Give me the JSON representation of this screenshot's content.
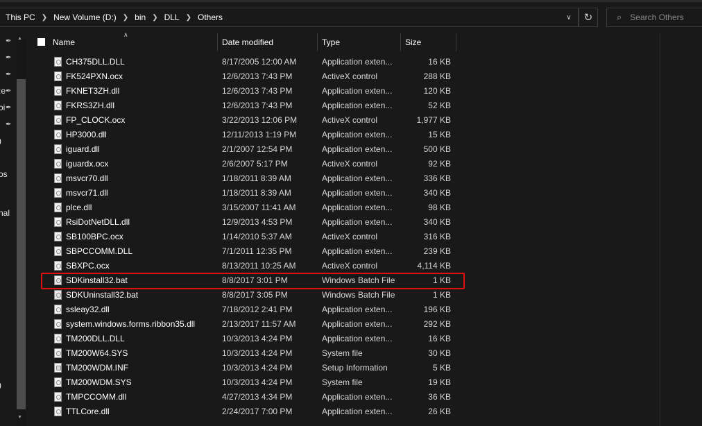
{
  "address": {
    "breadcrumbs": [
      "This PC",
      "New Volume (D:)",
      "bin",
      "DLL",
      "Others"
    ]
  },
  "search": {
    "placeholder": "Search Others"
  },
  "nav_fragments": [
    ":e",
    "oi",
    ")",
    "os",
    "nal",
    ")"
  ],
  "columns": {
    "name": "Name",
    "date": "Date modified",
    "type": "Type",
    "size": "Size"
  },
  "files": [
    {
      "name": "CH375DLL.DLL",
      "date": "8/17/2005 12:00 AM",
      "type": "Application exten...",
      "size": "16 KB",
      "icon": "dll"
    },
    {
      "name": "FK524PXN.ocx",
      "date": "12/6/2013 7:43 PM",
      "type": "ActiveX control",
      "size": "288 KB",
      "icon": "dll"
    },
    {
      "name": "FKNET3ZH.dll",
      "date": "12/6/2013 7:43 PM",
      "type": "Application exten...",
      "size": "120 KB",
      "icon": "dll"
    },
    {
      "name": "FKRS3ZH.dll",
      "date": "12/6/2013 7:43 PM",
      "type": "Application exten...",
      "size": "52 KB",
      "icon": "dll"
    },
    {
      "name": "FP_CLOCK.ocx",
      "date": "3/22/2013 12:06 PM",
      "type": "ActiveX control",
      "size": "1,977 KB",
      "icon": "dll"
    },
    {
      "name": "HP3000.dll",
      "date": "12/11/2013 1:19 PM",
      "type": "Application exten...",
      "size": "15 KB",
      "icon": "dll"
    },
    {
      "name": "iguard.dll",
      "date": "2/1/2007 12:54 PM",
      "type": "Application exten...",
      "size": "500 KB",
      "icon": "dll"
    },
    {
      "name": "iguardx.ocx",
      "date": "2/6/2007 5:17 PM",
      "type": "ActiveX control",
      "size": "92 KB",
      "icon": "dll"
    },
    {
      "name": "msvcr70.dll",
      "date": "1/18/2011 8:39 AM",
      "type": "Application exten...",
      "size": "336 KB",
      "icon": "dll"
    },
    {
      "name": "msvcr71.dll",
      "date": "1/18/2011 8:39 AM",
      "type": "Application exten...",
      "size": "340 KB",
      "icon": "dll"
    },
    {
      "name": "plce.dll",
      "date": "3/15/2007 11:41 AM",
      "type": "Application exten...",
      "size": "98 KB",
      "icon": "dll"
    },
    {
      "name": "RsiDotNetDLL.dll",
      "date": "12/9/2013 4:53 PM",
      "type": "Application exten...",
      "size": "340 KB",
      "icon": "dll"
    },
    {
      "name": "SB100BPC.ocx",
      "date": "1/14/2010 5:37 AM",
      "type": "ActiveX control",
      "size": "316 KB",
      "icon": "dll"
    },
    {
      "name": "SBPCCOMM.DLL",
      "date": "7/1/2011 12:35 PM",
      "type": "Application exten...",
      "size": "239 KB",
      "icon": "dll"
    },
    {
      "name": "SBXPC.ocx",
      "date": "8/13/2011 10:25 AM",
      "type": "ActiveX control",
      "size": "4,114 KB",
      "icon": "dll"
    },
    {
      "name": "SDKinstall32.bat",
      "date": "8/8/2017 3:01 PM",
      "type": "Windows Batch File",
      "size": "1 KB",
      "icon": "bat"
    },
    {
      "name": "SDKUninstall32.bat",
      "date": "8/8/2017 3:05 PM",
      "type": "Windows Batch File",
      "size": "1 KB",
      "icon": "bat"
    },
    {
      "name": "ssleay32.dll",
      "date": "7/18/2012 2:41 PM",
      "type": "Application exten...",
      "size": "196 KB",
      "icon": "dll"
    },
    {
      "name": "system.windows.forms.ribbon35.dll",
      "date": "2/13/2017 11:57 AM",
      "type": "Application exten...",
      "size": "292 KB",
      "icon": "dll"
    },
    {
      "name": "TM200DLL.DLL",
      "date": "10/3/2013 4:24 PM",
      "type": "Application exten...",
      "size": "16 KB",
      "icon": "dll"
    },
    {
      "name": "TM200W64.SYS",
      "date": "10/3/2013 4:24 PM",
      "type": "System file",
      "size": "30 KB",
      "icon": "sys"
    },
    {
      "name": "TM200WDM.INF",
      "date": "10/3/2013 4:24 PM",
      "type": "Setup Information",
      "size": "5 KB",
      "icon": "inf"
    },
    {
      "name": "TM200WDM.SYS",
      "date": "10/3/2013 4:24 PM",
      "type": "System file",
      "size": "19 KB",
      "icon": "sys"
    },
    {
      "name": "TMPCCOMM.dll",
      "date": "4/27/2013 4:34 PM",
      "type": "Application exten...",
      "size": "36 KB",
      "icon": "dll"
    },
    {
      "name": "TTLCore.dll",
      "date": "2/24/2017 7:00 PM",
      "type": "Application exten...",
      "size": "26 KB",
      "icon": "dll"
    }
  ]
}
